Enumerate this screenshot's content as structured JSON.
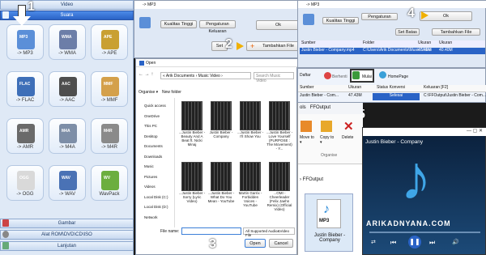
{
  "steps": {
    "s1": "1",
    "s2": "2",
    "s3": "3",
    "s4": "4",
    "s5": "5"
  },
  "left": {
    "video": "Video",
    "audio": "Suara",
    "picture": "Gambar",
    "rom": "Alat ROM\\DVD\\CD\\ISO",
    "advanced": "Lanjutan",
    "formats": [
      {
        "label": "-> MP3",
        "badge": "MP3",
        "color": "#5b8fd8"
      },
      {
        "label": "-> WMA",
        "badge": "WMA",
        "color": "#6c7ea8"
      },
      {
        "label": "-> APE",
        "badge": "APE",
        "color": "#c9a032"
      },
      {
        "label": "-> FLAC",
        "badge": "FLAC",
        "color": "#3e6fb8"
      },
      {
        "label": "-> AAC",
        "badge": "AAC",
        "color": "#4e4e4e"
      },
      {
        "label": "-> MMF",
        "badge": "MMF",
        "color": "#d4a04a"
      },
      {
        "label": "-> AMR",
        "badge": "AMR",
        "color": "#6a6a6a"
      },
      {
        "label": "-> M4A",
        "badge": "M4A",
        "color": "#7d8ea7"
      },
      {
        "label": "-> M4R",
        "badge": "M4R",
        "color": "#8a8a8a"
      },
      {
        "label": "-> OGG",
        "badge": "OGG",
        "color": "#d9d9d9"
      },
      {
        "label": "-> WAV",
        "badge": "WAV",
        "color": "#4a72b5"
      },
      {
        "label": "WavPack",
        "badge": "WV",
        "color": "#6cae3f"
      }
    ]
  },
  "mp3win": {
    "title": "-> MP3",
    "quality": "Kualitas Tinggi",
    "ok": "Ok",
    "settings": "Pengaturan Keluaran",
    "addfile": "Tambahkan File",
    "set": "Set"
  },
  "dialog": {
    "title": "Open",
    "path": "« Arik Documents › Music Video ›",
    "search": "Search Music Video",
    "organise": "Organise ▾",
    "newfolder": "New folder",
    "nav": [
      "Quick access",
      "OneDrive",
      "This PC",
      "Desktop",
      "Documents",
      "Downloads",
      "Music",
      "Pictures",
      "Videos",
      "Local Disk (C:)",
      "Local Disk (D:)",
      "Network"
    ],
    "files": [
      "...Justin Bieber - Beauty And A Beat ft. Nicki Minaj",
      "Justin Bieber - Company",
      "...Justin Bieber - I'll Show You",
      "...Justin Bieber - Love Yourself (PURPOSE : The Movement) - Y...",
      "...Justin Bieber - Sorry (Lyric Video)",
      "...Justin Bieber - What Do You Mean - YouTube",
      "Martin Garrix - Forbidden Voices - YouTube",
      "...OMI - Cheerleader (Felix Jaehn Remix) (Official Video)"
    ],
    "filename_label": "File name:",
    "filetype": "All Supported Audio&Video File",
    "open": "Open",
    "cancel": "Cancel"
  },
  "listwin": {
    "title": "-> MP3",
    "quality": "Kualitas Tinggi",
    "ok": "Ok",
    "settings": "Pengaturan",
    "setbatas": "Set Batas",
    "addfile": "Tambahkan File",
    "cols": [
      "Sumber",
      "Folder",
      "Ukuran",
      "Ukuran"
    ],
    "row": [
      "Justin Bieber - Company.mp4",
      "C:\\Users\\Arik Documents\\Music Video",
      "40.40M",
      "40.40M"
    ]
  },
  "mainwin": {
    "tasklist": "Daftar",
    "stop": "Berhenti",
    "start": "Mulai",
    "homepage": "HomePage",
    "cols": [
      "Sumber",
      "Ukuran",
      "Status Konversi",
      "Keluaran [F2]"
    ],
    "row": [
      "Justin Bieber - Com...",
      "47.43M",
      "Selesai",
      "C:\\FFOutput\\Justin Bieber - Com..."
    ]
  },
  "explorer": {
    "tab": "ols",
    "title": "FFOutput",
    "move": "Move to ▾",
    "copy": "Copy to ▾",
    "delete": "Delete",
    "organise": "Organise",
    "crumb": "› FFOutput",
    "fileicon": "MP3",
    "filename": "Justin Bieber - Company"
  },
  "player": {
    "title": "Justin Bieber - Company",
    "watermark": "ARIKADNYANA.COM"
  },
  "colors": {
    "accent": "#2a63c6",
    "step_arrow": "#f0b000",
    "player_bg": "#0d2a4a"
  }
}
